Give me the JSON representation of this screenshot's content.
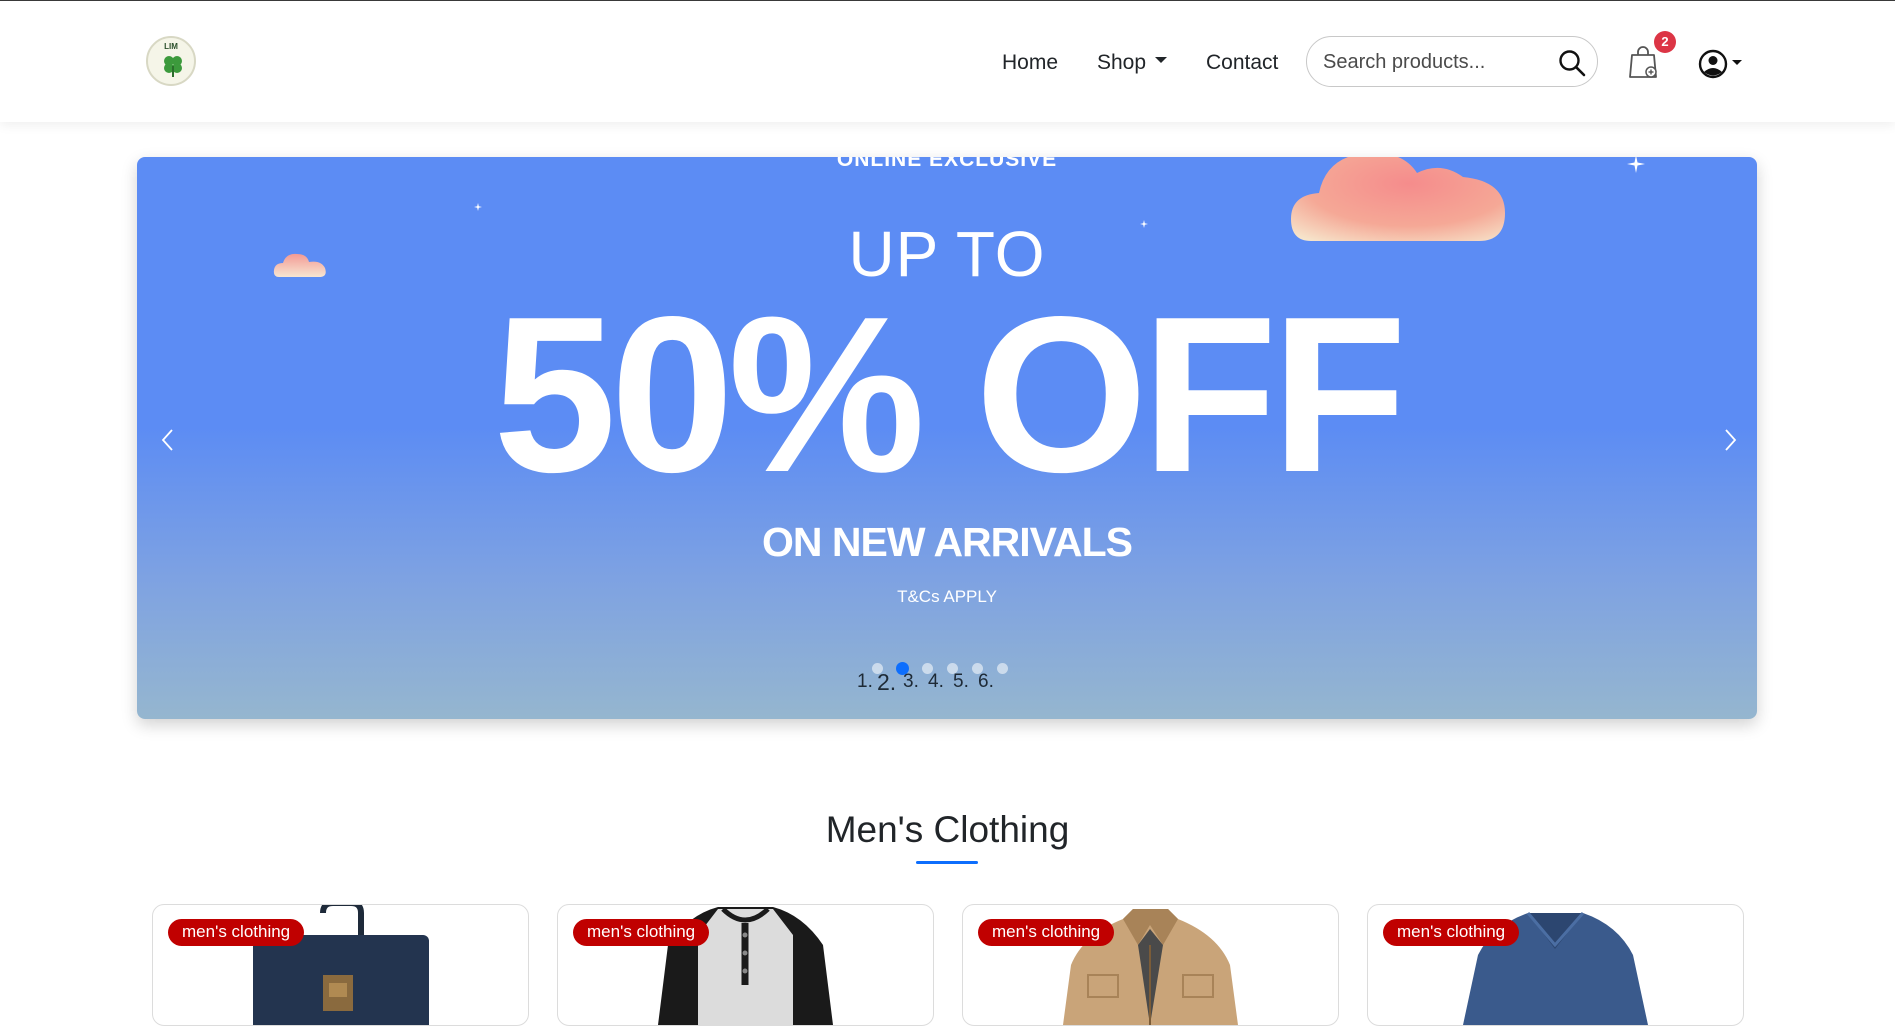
{
  "navbar": {
    "logo_text": "LIM",
    "links": {
      "home": "Home",
      "shop": "Shop",
      "contact": "Contact"
    },
    "search": {
      "placeholder": "Search products...",
      "value": ""
    },
    "cart_count": "2",
    "icons": [
      "search-icon",
      "shopping-bag-icon",
      "user-circle-icon",
      "caret-down-icon"
    ]
  },
  "carousel": {
    "kicker": "ONLINE EXCLUSIVE",
    "headline_small": "UP TO",
    "headline_big": "50% OFF",
    "subheadline": "ON NEW ARRIVALS",
    "terms": "T&Cs APPLY",
    "active_slide": 2,
    "indicator_labels": [
      "1.",
      "2.",
      "3.",
      "4.",
      "5.",
      "6."
    ],
    "colors": {
      "top": "#5c8cf4",
      "bottom": "#95b6cf",
      "active_indicator": "#0d6efd"
    }
  },
  "section": {
    "title": "Men's Clothing",
    "accent_color": "#0d6efd"
  },
  "products": [
    {
      "category": "men's clothing",
      "item": "backpack"
    },
    {
      "category": "men's clothing",
      "item": "raglan henley shirt"
    },
    {
      "category": "men's clothing",
      "item": "jacket"
    },
    {
      "category": "men's clothing",
      "item": "v-neck long sleeve tee"
    }
  ],
  "colors": {
    "badge": "#dc3545",
    "category_tag": "#c00000"
  }
}
